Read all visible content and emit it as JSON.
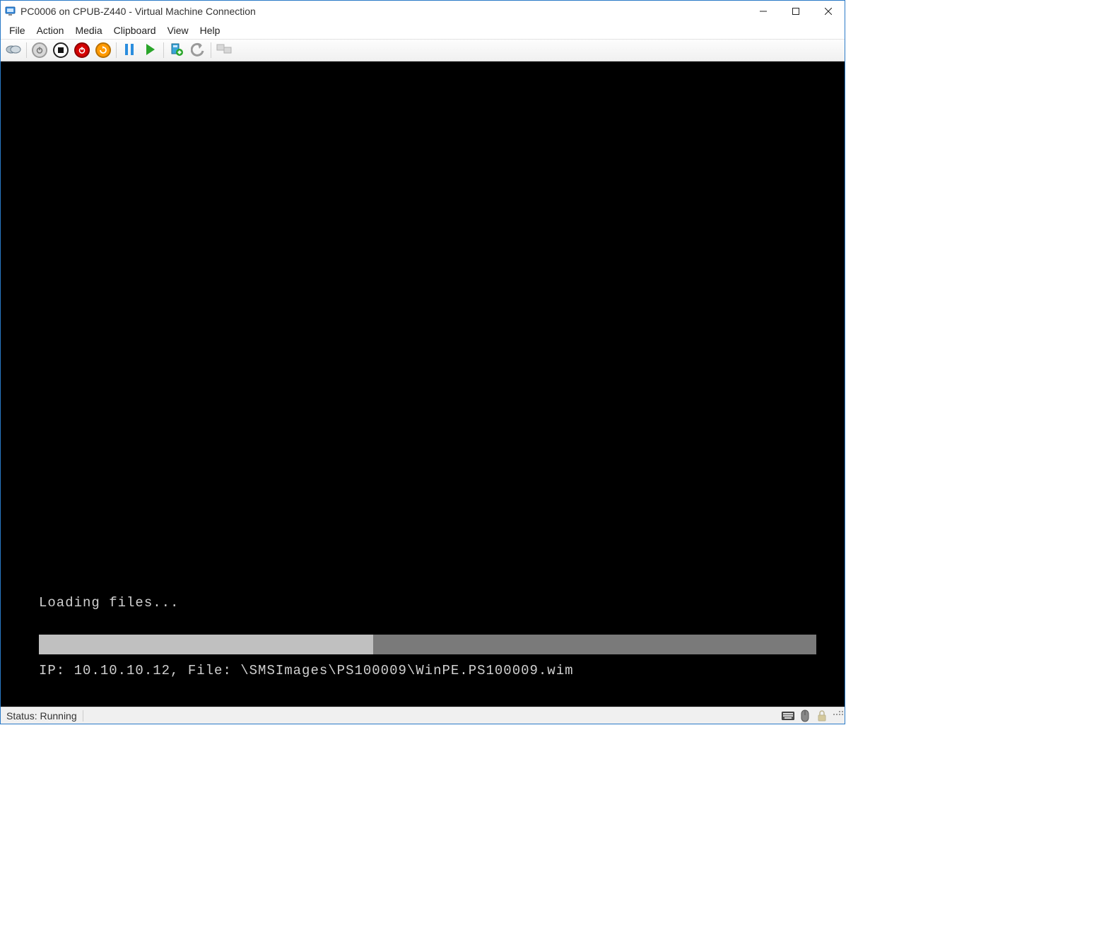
{
  "window": {
    "title": "PC0006 on CPUB-Z440 - Virtual Machine Connection"
  },
  "menubar": {
    "items": [
      "File",
      "Action",
      "Media",
      "Clipboard",
      "View",
      "Help"
    ]
  },
  "toolbar": {
    "buttons": [
      {
        "name": "ctrl-alt-del-icon",
        "semantic": "Ctrl+Alt+Del"
      },
      {
        "name": "power-off-icon",
        "semantic": "Turn Off"
      },
      {
        "name": "stop-icon",
        "semantic": "Shut Down"
      },
      {
        "name": "force-off-icon",
        "semantic": "Force Off"
      },
      {
        "name": "reset-icon",
        "semantic": "Reset"
      },
      {
        "name": "pause-icon",
        "semantic": "Pause"
      },
      {
        "name": "start-icon",
        "semantic": "Start"
      },
      {
        "name": "checkpoint-icon",
        "semantic": "Checkpoint"
      },
      {
        "name": "revert-icon",
        "semantic": "Revert"
      },
      {
        "name": "enhanced-session-icon",
        "semantic": "Enhanced Session"
      }
    ]
  },
  "vm": {
    "loading_label": "Loading files...",
    "progress_pct": 43,
    "detail_line": "IP: 10.10.10.12, File: \\SMSImages\\PS100009\\WinPE.PS100009.wim"
  },
  "statusbar": {
    "text": "Status: Running"
  }
}
